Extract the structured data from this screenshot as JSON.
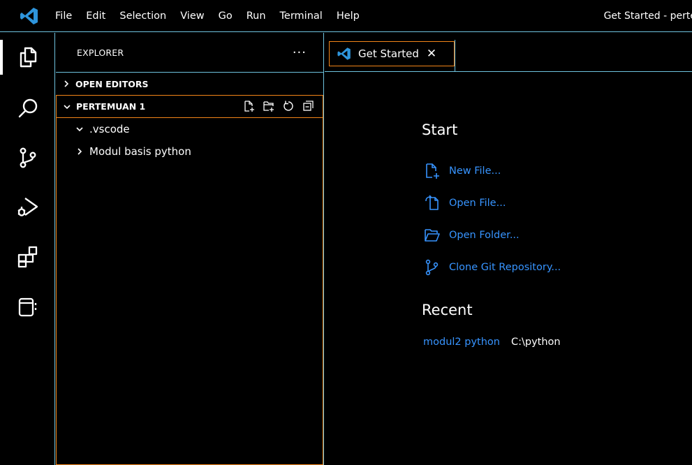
{
  "titlebar": {
    "menu": [
      "File",
      "Edit",
      "Selection",
      "View",
      "Go",
      "Run",
      "Terminal",
      "Help"
    ],
    "window_title": "Get Started - perte"
  },
  "activity_bar": {
    "items": [
      "explorer-icon",
      "search-icon",
      "source-control-icon",
      "run-debug-icon",
      "extensions-icon",
      "remote-explorer-icon"
    ]
  },
  "explorer": {
    "title": "EXPLORER",
    "more": "···",
    "open_editors": "OPEN EDITORS",
    "folder": "PERTEMUAN 1",
    "tree": [
      {
        "label": ".vscode",
        "expanded": true
      },
      {
        "label": "Modul basis python",
        "expanded": false
      }
    ]
  },
  "tabs": [
    {
      "label": "Get Started",
      "close": "✕"
    }
  ],
  "welcome": {
    "start_heading": "Start",
    "start_items": [
      "New File...",
      "Open File...",
      "Open Folder...",
      "Clone Git Repository..."
    ],
    "recent_heading": "Recent",
    "recent": [
      {
        "name": "modul2 python",
        "path": "C:\\python"
      }
    ]
  },
  "colors": {
    "contrast_border": "#6fc3df",
    "focus_border": "#f38518",
    "link": "#3794ff",
    "vscode_blue": "#2e95dc"
  }
}
